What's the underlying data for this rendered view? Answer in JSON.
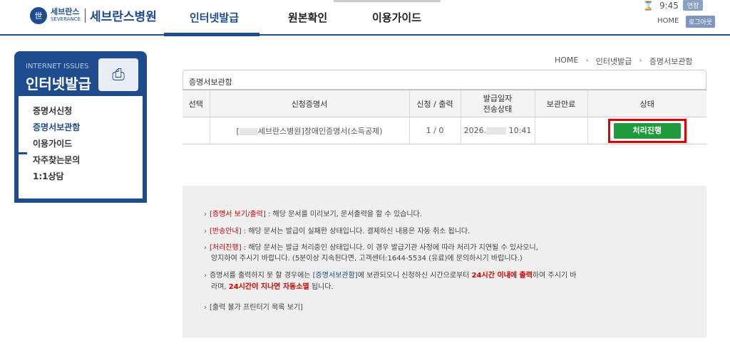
{
  "header": {
    "logo_seal": "世",
    "logo_small_ko": "세브란스",
    "logo_small_en": "SEVERANCE",
    "logo_name": "세브란스병원",
    "nav": [
      "인터넷발급",
      "원본확인",
      "이용가이드"
    ],
    "time": "9:45",
    "extend_label": "연장",
    "home_label": "HOME",
    "logout_label": "로그아웃"
  },
  "sidebar": {
    "en_title": "INTERNET ISSUES",
    "title": "인터넷발급",
    "items": [
      "증명서신청",
      "증명서보관함",
      "이용가이드",
      "자주찾는문의",
      "1:1상담"
    ]
  },
  "breadcrumb": [
    "HOME",
    "인터넷발급",
    "증명서보관함"
  ],
  "panel": {
    "title": "증명서보관함",
    "columns": [
      "선택",
      "신청증명서",
      "신청 / 출력",
      "발급일자\n전송상태",
      "보관만료",
      "상태"
    ],
    "rows": [
      {
        "select": "",
        "cert_prefix": "[",
        "cert_name": "세브란스병원]장애인증명서(소득공제)",
        "count": "1 / 0",
        "date_prefix": "2026.",
        "date_suffix": "10:41",
        "expire": "",
        "status": "처리진행"
      }
    ]
  },
  "notice": {
    "l1_tag": "[증명서 보기/출력]",
    "l1_text": " : 해당 문서를 미리보기, 문서출력을 할 수 있습니다.",
    "l2_tag": "[반송안내]",
    "l2_text": " : 해당 문서는 발급이 실패한 상태입니다. 결제하신 내용은 자동 취소 됩니다.",
    "l3_tag": "[처리진행]",
    "l3_text": " : 해당 문서는 발급 처리중인 상태입니다. 이 경우 발급기관 사정에 따라 처리가 지연될 수 있사오니,",
    "l3b": "양지하여 주시기 바랍니다. (5분이상 지속된다면, 고객센터:1644-5534 (유료)에 문의하시기 바랍니다.)",
    "l4_a": "증명서를 출력하지 못 할 경우에는 ",
    "l4_tag": "[증명서보관함]",
    "l4_b": "에 보관되오니 신청하신 시간으로부터 ",
    "l4_red": "24시간 이내에 출력",
    "l4_c": "하여 주시기 바",
    "l4b_a": "라며, ",
    "l4b_red": "24시간이 지나면 자동소멸",
    "l4b_b": " 됩니다.",
    "l5": "[출력 불가 프린터기 목록 보기]"
  }
}
